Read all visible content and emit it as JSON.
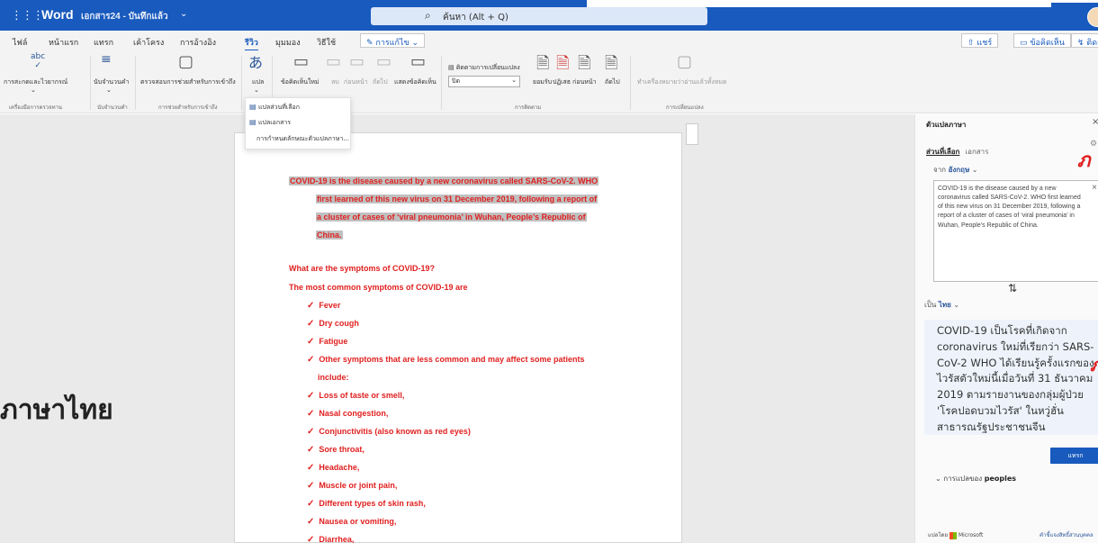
{
  "titlebar": {
    "app_name": "Word",
    "doc_name": "เอกสาร24 - บันทึกแล้ว",
    "search_placeholder": "ค้นหา (Alt + Q)"
  },
  "menu": {
    "tabs": [
      "ไฟล์",
      "หน้าแรก",
      "แทรก",
      "เค้าโครง",
      "การอ้างอิง",
      "รีวิว",
      "มุมมอง",
      "วิธีใช้"
    ],
    "active_tab": "รีวิว",
    "editing_label": "การแก้ไข",
    "share": "แชร์",
    "comments": "ข้อคิดเห็น",
    "tracking": "ติดตาม"
  },
  "ribbon": {
    "spelling": "การสะกดและไวยากรณ์",
    "wordcount": "นับจำนวนคำ",
    "accessibility": "ตรวจสอบการช่วยสำหรับการเข้าถึง",
    "translate": "แปล",
    "new_comment": "ข้อคิดเห็นใหม่",
    "delete": "ลบ",
    "previous": "ก่อนหน้า",
    "next": "ถัดไป",
    "show_comments": "แสดงข้อคิดเห็น",
    "track_changes": "ติดตามการเปลี่ยนแปลง",
    "track_select": "ปิด",
    "accept": "ยอมรับ",
    "reject": "ปฏิเสธ",
    "prev_change": "ก่อนหน้า",
    "next_change": "ถัดไป",
    "mark_all": "ทำเครื่องหมายว่าอ่านแล้วทั้งหมด",
    "group_proofing": "เครื่องมือการตรวจทาน",
    "group_wordcount": "นับจำนวนคำ",
    "group_access": "การช่วยสำหรับการเข้าถึง",
    "group_tracking": "การติดตาม",
    "group_changes": "การเปลี่ยนแปลง"
  },
  "translate_menu": {
    "selection": "แปลส่วนที่เลือก",
    "document": "แปลเอกสาร",
    "settings": "การกำหนดลักษณะตัวแปลภาษา..."
  },
  "overlay_text": "ภาษาไทย",
  "document": {
    "para1": [
      "COVID-19 is the disease caused by a new coronavirus called SARS-CoV-2.  WHO",
      "first learned of this new virus on 31 December 2019, following a report of",
      "a cluster of cases of ‘viral pneumonia’ in Wuhan, People’s Republic of",
      "China."
    ],
    "heading": "What are the symptoms of COVID-19?",
    "sub": "The most common symptoms of COVID-19 are",
    "symptoms": [
      "Fever",
      "Dry cough",
      "Fatigue",
      "Other symptoms that are less common and may affect some patients",
      "Loss of taste or smell,",
      "Nasal congestion,",
      "Conjunctivitis (also known as red eyes)",
      "Sore throat,",
      "Headache,",
      "Muscle or joint pain,",
      "Different types of skin rash,",
      "Nausea or vomiting,",
      "Diarrhea,"
    ],
    "symptom_cont": "include:"
  },
  "pane": {
    "title": "ตัวแปลภาษา",
    "tab_selection": "ส่วนที่เลือก",
    "tab_document": "เอกสาร",
    "red_glyph": "ภ",
    "from_label": "จาก",
    "from_lang": "อังกฤษ",
    "source_text": "COVID-19 is the disease caused by a new coronavirus called SARS-CoV-2.  WHO first learned of this new virus on 31 December 2019, following a report of a cluster of cases of ‘viral pneumonia’ in Wuhan, People’s Republic of China.",
    "to_label": "เป็น",
    "to_lang": "ไทย",
    "output_text": "COVID-19 เป็นโรคที่เกิดจาก coronavirus ใหม่ที่เรียกว่า SARS-CoV-2  WHO ได้เรียนรู้ครั้งแรกของไวรัสตัวใหม่นี้เมื่อวันที่ 31 ธันวาคม 2019 ตามรายงานของกลุ่มผู้ป่วย 'โรคปอดบวมไวรัส' ในหวู่ฮั่นสาธารณรัฐประชาชนจีน",
    "insert": "แทรก",
    "alt_prefix": "การแปลของ",
    "alt_word": "peoples",
    "footer_by": "แปลโดย",
    "footer_ms": "Microsoft",
    "footer_privacy": "คำชี้แจงสิทธิ์ส่วนบุคคล"
  }
}
